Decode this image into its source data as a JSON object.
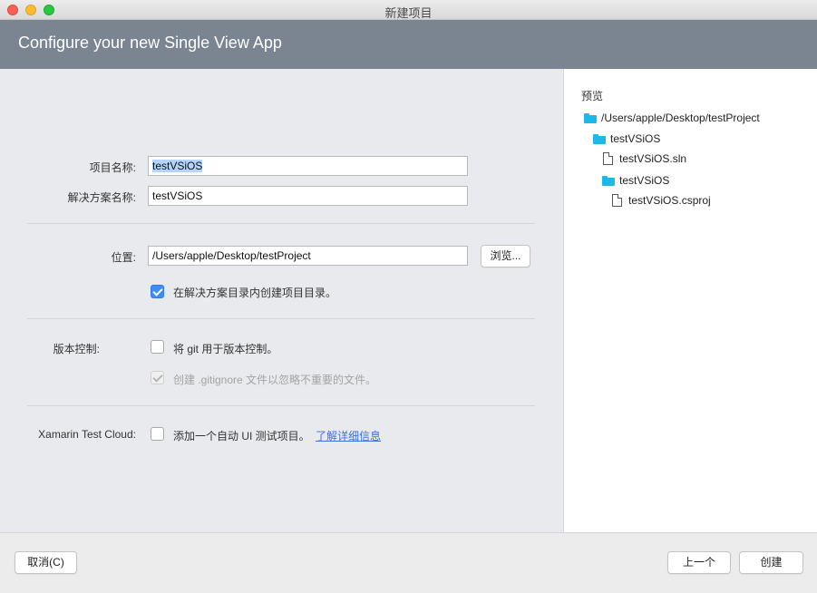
{
  "window": {
    "title": "新建项目"
  },
  "header": {
    "title": "Configure your new Single View App"
  },
  "form": {
    "project_name_label": "项目名称:",
    "project_name_value": "testVSiOS",
    "solution_name_label": "解决方案名称:",
    "solution_name_value": "testVSiOS",
    "location_label": "位置:",
    "location_value": "/Users/apple/Desktop/testProject",
    "browse_label": "浏览...",
    "create_dir_label": "在解决方案目录内创建项目目录。",
    "create_dir_checked": true,
    "vcs_label": "版本控制:",
    "git_label": "将 git 用于版本控制。",
    "git_checked": false,
    "gitignore_label": "创建 .gitignore 文件以忽略不重要的文件。",
    "gitignore_checked": true,
    "test_cloud_label": "Xamarin Test Cloud:",
    "ui_test_label": "添加一个自动 UI 测试项目。",
    "ui_test_checked": false,
    "learn_more_label": "了解详细信息"
  },
  "preview": {
    "title": "预览",
    "tree": [
      {
        "type": "folder",
        "name": "/Users/apple/Desktop/testProject",
        "depth": 0
      },
      {
        "type": "folder",
        "name": "testVSiOS",
        "depth": 1
      },
      {
        "type": "file",
        "name": "testVSiOS.sln",
        "depth": 2
      },
      {
        "type": "folder",
        "name": "testVSiOS",
        "depth": 2
      },
      {
        "type": "file",
        "name": "testVSiOS.csproj",
        "depth": 3
      }
    ]
  },
  "footer": {
    "cancel_label": "取消(C)",
    "back_label": "上一个",
    "create_label": "创建"
  },
  "colors": {
    "header_bg": "#7a8591",
    "accent": "#3d8df5",
    "folder": "#1cb8e8",
    "link": "#3b73e0"
  }
}
